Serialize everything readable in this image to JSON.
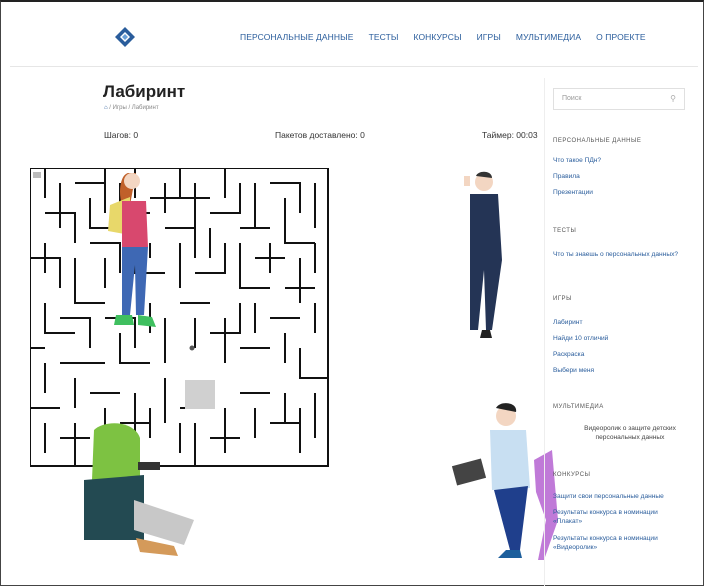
{
  "nav": {
    "items": [
      "ПЕРСОНАЛЬНЫЕ ДАННЫЕ",
      "ТЕСТЫ",
      "КОНКУРСЫ",
      "ИГРЫ",
      "МУЛЬТИМЕДИА",
      "О ПРОЕКТЕ"
    ]
  },
  "page": {
    "title": "Лабиринт",
    "breadcrumb": "/ Игры / Лабиринт"
  },
  "game": {
    "steps": "Шагов: 0",
    "packets": "Пакетов доставлено: 0",
    "timer": "Таймер: 00:03"
  },
  "sidebar": {
    "search_placeholder": "Поиск",
    "sections": [
      {
        "heading": "ПЕРСОНАЛЬНЫЕ ДАННЫЕ",
        "links": [
          "Что такое ПДн?",
          "Правила",
          "Презентации"
        ]
      },
      {
        "heading": "ТЕСТЫ",
        "links": [
          "Что ты знаешь о персональных данных?"
        ]
      },
      {
        "heading": "ИГРЫ",
        "links": [
          "Лабиринт",
          "Найди 10 отличий",
          "Раскраска",
          "Выбери меня"
        ]
      },
      {
        "heading": "МУЛЬТИМЕДИА",
        "links": [
          "Видеоролик о защите детских персональных данных"
        ]
      },
      {
        "heading": "КОНКУРСЫ",
        "links": [
          "Защити свои персональные данные",
          "Результаты конкурса в номинации «Плакат»",
          "Результаты конкурса в номинации «Видеоролик»"
        ]
      }
    ]
  },
  "colors": {
    "link": "#2a5d9c",
    "logo": "#2a5d9c",
    "target_cell": "#d0d0d0"
  }
}
